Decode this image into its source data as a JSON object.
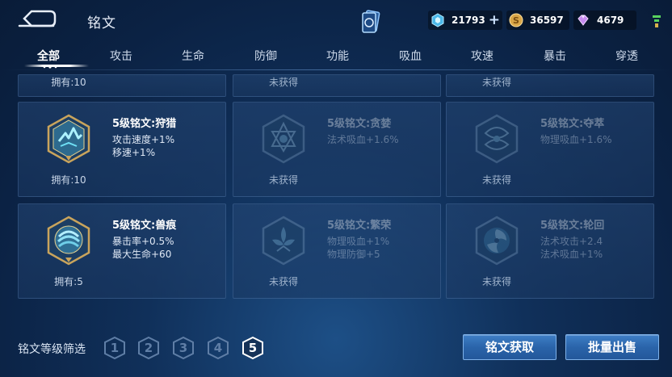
{
  "header": {
    "title": "铭文",
    "currencies": [
      {
        "icon": "diamond-icon",
        "value": "21793",
        "has_plus": true
      },
      {
        "icon": "gold-coin-icon",
        "value": "36597"
      },
      {
        "icon": "crystal-icon",
        "value": "4679"
      }
    ]
  },
  "tabs": [
    {
      "label": "全部",
      "active": true
    },
    {
      "label": "攻击"
    },
    {
      "label": "生命"
    },
    {
      "label": "防御"
    },
    {
      "label": "功能"
    },
    {
      "label": "吸血"
    },
    {
      "label": "攻速"
    },
    {
      "label": "暴击"
    },
    {
      "label": "穿透"
    }
  ],
  "top_row": [
    "拥有:10",
    "未获得",
    "未获得"
  ],
  "cards": [
    {
      "name": "5级铭文:狩猎",
      "attrs": [
        "攻击速度+1%",
        "移速+1%"
      ],
      "owned": "拥有:10",
      "locked": false,
      "color": "#5fd2e8"
    },
    {
      "name": "5级铭文:贪婪",
      "attrs": [
        "法术吸血+1.6%"
      ],
      "owned": "未获得",
      "locked": true,
      "color": "#5fa8c8"
    },
    {
      "name": "5级铭文:夺萃",
      "attrs": [
        "物理吸血+1.6%"
      ],
      "owned": "未获得",
      "locked": true,
      "color": "#5fa8c8"
    },
    {
      "name": "5级铭文:兽痕",
      "attrs": [
        "暴击率+0.5%",
        "最大生命+60"
      ],
      "owned": "拥有:5",
      "locked": false,
      "color": "#5fc0e8"
    },
    {
      "name": "5级铭文:繁荣",
      "attrs": [
        "物理吸血+1%",
        "物理防御+5"
      ],
      "owned": "未获得",
      "locked": true,
      "color": "#5fa8c8"
    },
    {
      "name": "5级铭文:轮回",
      "attrs": [
        "法术攻击+2.4",
        "法术吸血+1%"
      ],
      "owned": "未获得",
      "locked": true,
      "color": "#5fa8c8"
    }
  ],
  "footer": {
    "filter_label": "铭文等级筛选",
    "levels": [
      "1",
      "2",
      "3",
      "4",
      "5"
    ],
    "active_level": "5",
    "get_button": "铭文获取",
    "sell_button": "批量出售"
  },
  "colors": {
    "accent": "#3f7fc6",
    "gold": "#c9a45c",
    "bg": "#10305a"
  }
}
